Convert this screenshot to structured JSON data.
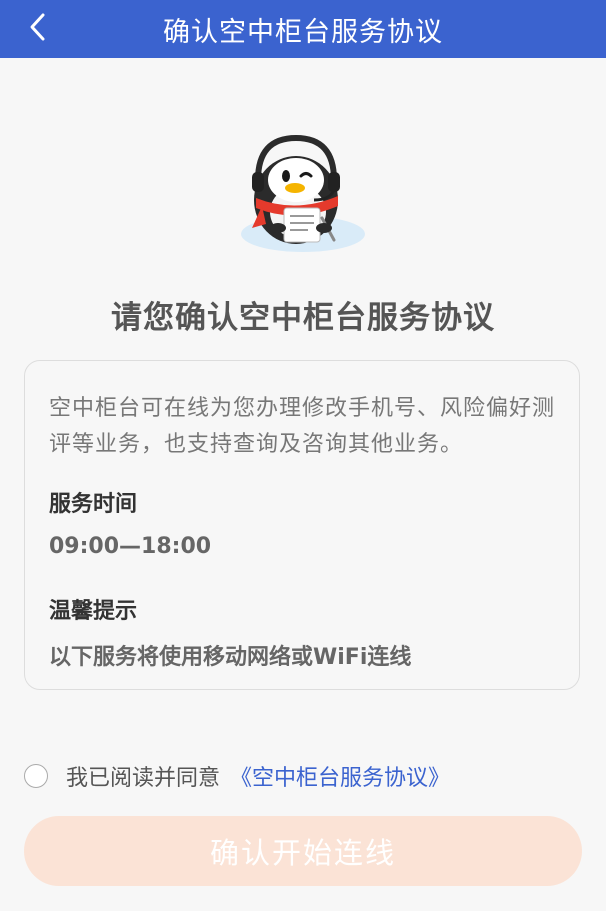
{
  "header": {
    "title": "确认空中柜台服务协议",
    "back_icon": "chevron-left-icon"
  },
  "mascot": {
    "icon": "penguin-customer-service-mascot"
  },
  "main": {
    "heading": "请您确认空中柜台服务协议",
    "card": {
      "description": "空中柜台可在线为您办理修改手机号、风险偏好测评等业务，也支持查询及咨询其他业务。",
      "service_time_label": "服务时间",
      "service_time_value": "09:00—18:00",
      "tip_label": "温馨提示",
      "tip_value": "以下服务将使用移动网络或WiFi连线"
    }
  },
  "agreement": {
    "checked": false,
    "text": "我已阅读并同意",
    "link": "《空中柜台服务协议》"
  },
  "confirm_button": {
    "label": "确认开始连线",
    "enabled": false
  },
  "colors": {
    "header_bg": "#3b63cf",
    "link": "#3b63cf",
    "button_disabled_bg": "#fbe3d6",
    "page_bg": "#f7f7f7"
  }
}
